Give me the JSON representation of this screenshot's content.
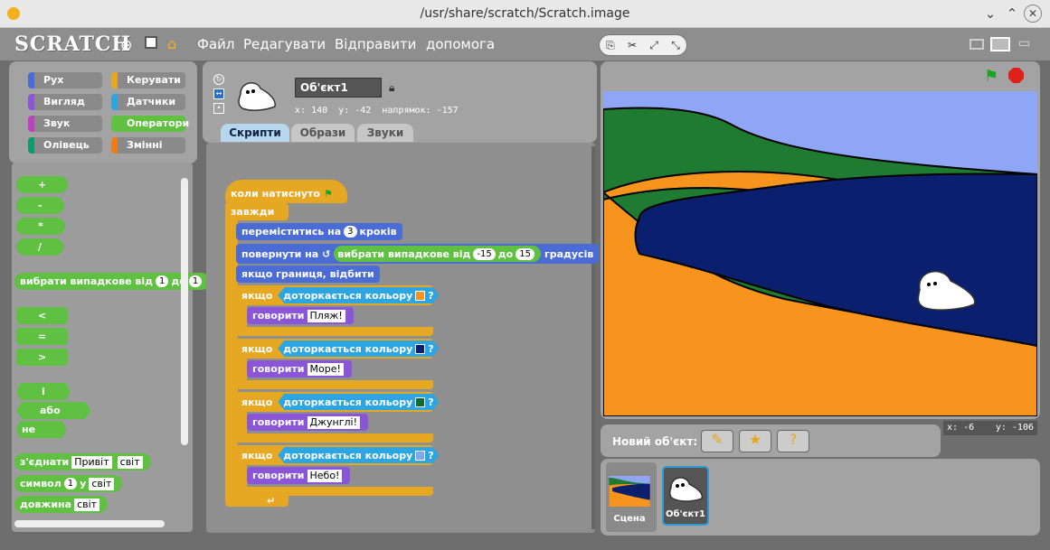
{
  "window": {
    "title": "/usr/share/scratch/Scratch.image"
  },
  "menu": {
    "logo": "SCRATCH",
    "file": "Файл",
    "edit": "Редагувати",
    "share": "Відправити",
    "help": "допомога"
  },
  "categories": [
    {
      "label": "Рух",
      "color": "#4a6cd4"
    },
    {
      "label": "Керувати",
      "color": "#e6a822"
    },
    {
      "label": "Вигляд",
      "color": "#8a55d7"
    },
    {
      "label": "Датчики",
      "color": "#2ca5e2"
    },
    {
      "label": "Звук",
      "color": "#bb42c3"
    },
    {
      "label": "Оператори",
      "color": "#5fc042"
    },
    {
      "label": "Олівець",
      "color": "#0e9a6c"
    },
    {
      "label": "Змінні",
      "color": "#ee7d16"
    }
  ],
  "palette": {
    "ops": [
      "+",
      "-",
      "*",
      "/"
    ],
    "random": {
      "label": "вибрати випадкове від",
      "from": "1",
      "to_label": "до",
      "to": "1"
    },
    "compare": [
      "<",
      "=",
      ">"
    ],
    "logic": [
      "і",
      "або",
      "не"
    ],
    "join": {
      "label": "з'єднати",
      "a": "Привіт",
      "b": "світ"
    },
    "letter": {
      "label": "символ",
      "n": "1",
      "of_label": "у",
      "word": "світ"
    },
    "length": {
      "label": "довжина",
      "word": "світ"
    }
  },
  "sprite": {
    "name": "Об'єкт1",
    "x_label": "x:",
    "x": "140",
    "y_label": "y:",
    "y": "-42",
    "dir_label": "напрямок:",
    "dir": "-157"
  },
  "tabs": {
    "scripts": "Скрипти",
    "costumes": "Образи",
    "sounds": "Звуки"
  },
  "script": {
    "hat": "коли натиснуто",
    "forever": "завжди",
    "move": {
      "label": "переміститись на",
      "steps": "3",
      "unit": "кроків"
    },
    "turn": {
      "label": "повернути на",
      "pick": "вибрати випадкове від",
      "from": "-15",
      "to_label": "до",
      "to": "15",
      "unit": "градусів"
    },
    "bounce": "якщо границя, відбити",
    "if_label": "якщо",
    "touching": "доторкається кольору",
    "q": "?",
    "say": "говорити",
    "branches": [
      {
        "color": "#f7941d",
        "text": "Пляж!"
      },
      {
        "color": "#0a1f6e",
        "text": "Море!"
      },
      {
        "color": "#0e6b33",
        "text": "Джунглі!"
      },
      {
        "color": "#7fa8e8",
        "text": "Небо!"
      }
    ]
  },
  "stage": {
    "mouse_x_label": "x:",
    "mouse_x": "-6",
    "mouse_y_label": "y:",
    "mouse_y": "-106"
  },
  "new_sprite": {
    "label": "Новий об'єкт:"
  },
  "sprites_panel": {
    "stage_label": "Сцена",
    "sprite_label": "Об'єкт1"
  },
  "colors": {
    "sky": "#8fa6f7",
    "jungle": "#1f7a32",
    "sand": "#f7941d",
    "sea": "#0a1f6e"
  }
}
